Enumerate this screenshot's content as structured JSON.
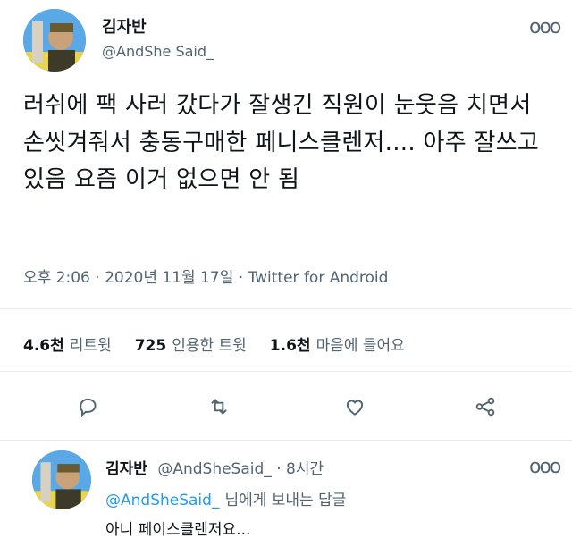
{
  "tweet": {
    "author_name": "김자반",
    "author_handle": "@AndShe Said_",
    "text": "러쉬에 팩 사러 갔다가 잘생긴 직원이 눈웃음 치면서 손씻겨줘서 충동구매한 페니스클렌저.... 아주 잘쓰고 있음 요즘 이거 없으면 안 됨",
    "time": "오후 2:06",
    "date": "2020년 11월 17일",
    "source": "Twitter for Android",
    "more_icon": "more-dots-icon"
  },
  "stats": {
    "retweets_count": "4.6천",
    "retweets_label": "리트윗",
    "quotes_count": "725",
    "quotes_label": "인용한 트윗",
    "likes_count": "1.6천",
    "likes_label": "마음에 들어요"
  },
  "actions": [
    "reply-icon",
    "retweet-icon",
    "like-icon",
    "share-icon"
  ],
  "reply": {
    "author_name": "김자반",
    "author_handle": "@AndSheSaid_",
    "age": "8시간",
    "mention": "@AndSheSaid_",
    "replying_label": "님에게 보내는 답글",
    "text": "아니 페이스클렌저요..."
  },
  "colors": {
    "link": "#1d9bf0",
    "muted": "#536471",
    "text": "#0f1419"
  }
}
